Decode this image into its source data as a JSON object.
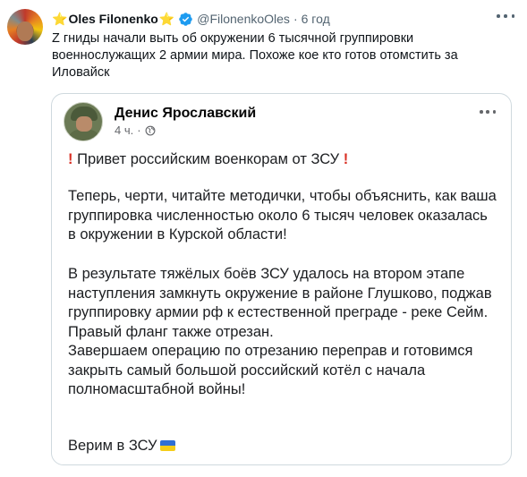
{
  "tweet": {
    "star_left": "⭐",
    "display_name": "Oles Filonenko",
    "star_right": "⭐",
    "handle": "@FilonenkoOles",
    "separator": "·",
    "time": "6 год",
    "text": "Z гниды начали выть об окружении 6 тысячной группировки военнослужащих 2 армии мира. Похоже кое кто готов отомстить за Иловайск"
  },
  "embedded_post": {
    "author": "Денис Ярославский",
    "time": "4 ч.",
    "separator": "·",
    "paragraph_1": "Привет российским военкорам от ЗСУ",
    "exclaim_mark": "!",
    "paragraph_2": "Теперь, черти, читайте методички, чтобы объяснить, как ваша группировка численностью около 6 тысяч человек оказалась в окружении в Курской области!",
    "paragraph_3a": "В результате тяжёлых боёв ЗСУ удалось на втором этапе наступления замкнуть окружение в районе Глушково, поджав группировку армии рф к естественной преграде - реке Сейм. Правый фланг также отрезан.",
    "paragraph_3b": "Завершаем операцию по отрезанию переправ и готовимся закрыть самый большой российский котёл с начала полномасштабной войны!",
    "paragraph_4": "Верим в ЗСУ"
  },
  "colors": {
    "text": "#0f1419",
    "muted": "#536471",
    "verified": "#1d9bf0",
    "card_border": "#cfd9de",
    "exclaim": "#d93025"
  },
  "icons": [
    "star-icon",
    "verified-badge-icon",
    "more-icon",
    "globe-icon",
    "ukraine-flag-icon"
  ]
}
